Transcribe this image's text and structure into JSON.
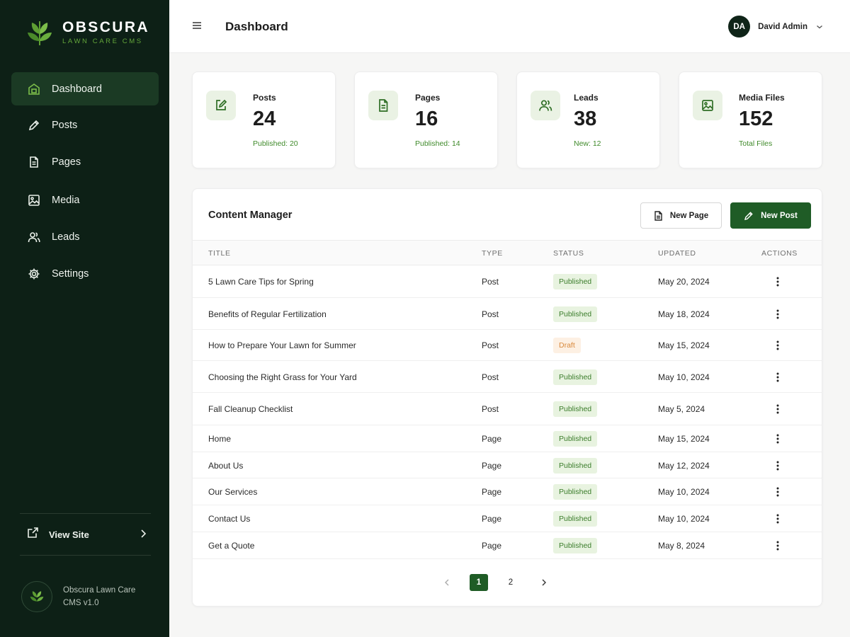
{
  "brand": {
    "name": "OBSCURA",
    "tagline": "LAWN CARE CMS"
  },
  "sidebar": {
    "items": [
      {
        "label": "Dashboard",
        "icon": "dashboard-icon",
        "active": true
      },
      {
        "label": "Posts",
        "icon": "pencil-icon"
      },
      {
        "label": "Pages",
        "icon": "document-icon"
      },
      {
        "label": "Media",
        "icon": "image-icon"
      },
      {
        "label": "Leads",
        "icon": "users-icon"
      },
      {
        "label": "Settings",
        "icon": "gear-icon"
      }
    ],
    "view_site": "View Site",
    "footer": "Obscura Lawn Care CMS v1.0"
  },
  "topbar": {
    "title": "Dashboard",
    "user_initials": "DA",
    "user_name": "David Admin"
  },
  "stats": [
    {
      "label": "Posts",
      "value": "24",
      "sub": "Published: 20",
      "icon": "edit-icon"
    },
    {
      "label": "Pages",
      "value": "16",
      "sub": "Published: 14",
      "icon": "document-icon"
    },
    {
      "label": "Leads",
      "value": "38",
      "sub": "New: 12",
      "icon": "users-icon"
    },
    {
      "label": "Media Files",
      "value": "152",
      "sub": "Total Files",
      "icon": "image-icon"
    }
  ],
  "content": {
    "title": "Content Manager",
    "new_page": "New Page",
    "new_post": "New Post",
    "columns": [
      "TITLE",
      "TYPE",
      "STATUS",
      "UPDATED",
      "ACTIONS"
    ],
    "rows": [
      {
        "title": "5 Lawn Care Tips for Spring",
        "type": "Post",
        "status": "Published",
        "updated": "May 20, 2024"
      },
      {
        "title": "Benefits of Regular Fertilization",
        "type": "Post",
        "status": "Published",
        "updated": "May 18, 2024"
      },
      {
        "title": "How to Prepare Your Lawn for Summer",
        "type": "Post",
        "status": "Draft",
        "updated": "May 15, 2024"
      },
      {
        "title": "Choosing the Right Grass for Your Yard",
        "type": "Post",
        "status": "Published",
        "updated": "May 10, 2024"
      },
      {
        "title": "Fall Cleanup Checklist",
        "type": "Post",
        "status": "Published",
        "updated": "May 5, 2024"
      },
      {
        "title": "Home",
        "type": "Page",
        "status": "Published",
        "updated": "May 15, 2024"
      },
      {
        "title": "About Us",
        "type": "Page",
        "status": "Published",
        "updated": "May 12, 2024"
      },
      {
        "title": "Our Services",
        "type": "Page",
        "status": "Published",
        "updated": "May 10, 2024"
      },
      {
        "title": "Contact Us",
        "type": "Page",
        "status": "Published",
        "updated": "May 10, 2024"
      },
      {
        "title": "Get a Quote",
        "type": "Page",
        "status": "Published",
        "updated": "May 8, 2024"
      }
    ],
    "pagination": {
      "current": "1",
      "pages": [
        "1",
        "2"
      ]
    }
  },
  "colors": {
    "sidebar_bg": "#0d2016",
    "accent": "#1f5c26",
    "accent_light": "#63a63a",
    "published_bg": "#e8f3e0",
    "draft_bg": "#fdf0e3"
  }
}
